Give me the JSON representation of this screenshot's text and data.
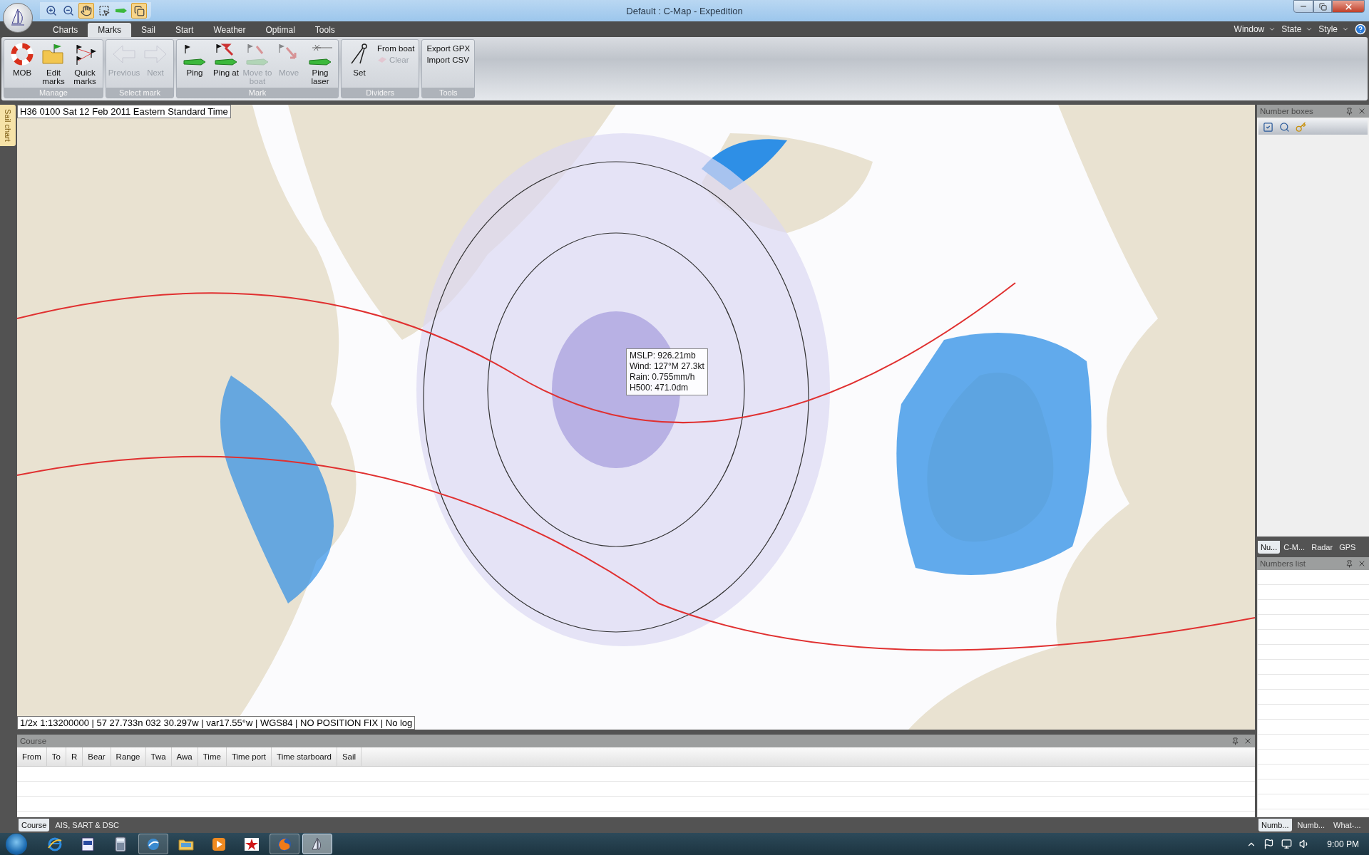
{
  "window": {
    "title": "Default : C-Map - Expedition"
  },
  "ribbon_tabs": [
    {
      "label": "Charts",
      "selected": false
    },
    {
      "label": "Marks",
      "selected": true
    },
    {
      "label": "Sail",
      "selected": false
    },
    {
      "label": "Start",
      "selected": false
    },
    {
      "label": "Weather",
      "selected": false
    },
    {
      "label": "Optimal",
      "selected": false
    },
    {
      "label": "Tools",
      "selected": false
    }
  ],
  "menu_right": [
    "Window",
    "State",
    "Style"
  ],
  "ribbon_groups": [
    {
      "title": "Manage",
      "buttons": [
        {
          "label": "MOB",
          "kind": "large",
          "disabled": false
        },
        {
          "label": "Edit marks",
          "kind": "large",
          "disabled": false
        },
        {
          "label": "Quick marks",
          "kind": "large",
          "disabled": false
        }
      ]
    },
    {
      "title": "Select mark",
      "buttons": [
        {
          "label": "Previous",
          "kind": "large",
          "disabled": true
        },
        {
          "label": "Next",
          "kind": "large",
          "disabled": true
        }
      ]
    },
    {
      "title": "Mark",
      "buttons": [
        {
          "label": "Ping",
          "kind": "large",
          "disabled": false
        },
        {
          "label": "Ping at",
          "kind": "large",
          "disabled": false
        },
        {
          "label": "Move to boat",
          "kind": "large",
          "disabled": true
        },
        {
          "label": "Move",
          "kind": "large",
          "disabled": true
        },
        {
          "label": "Ping laser",
          "kind": "large",
          "disabled": false
        }
      ]
    },
    {
      "title": "Dividers",
      "buttons": [
        {
          "label": "Set",
          "kind": "large",
          "disabled": false
        },
        {
          "label": "From boat",
          "kind": "small",
          "disabled": false
        },
        {
          "label": "Clear",
          "kind": "small",
          "disabled": true
        }
      ]
    },
    {
      "title": "Tools",
      "buttons": [
        {
          "label": "Export GPX",
          "kind": "small",
          "disabled": false
        },
        {
          "label": "Import CSV",
          "kind": "small",
          "disabled": false
        }
      ]
    }
  ],
  "side_tab": "Sail chart",
  "map": {
    "kind": "picture",
    "time_label": "H36 0100 Sat 12 Feb 2011 Eastern Standard Time",
    "tooltip": [
      "MSLP: 926.21mb",
      "Wind: 127°M 27.3kt",
      "Rain: 0.755mm/h",
      "H500: 471.0dm"
    ],
    "status_line": "1/2x 1:13200000 | 57 27.733n 032 30.297w | var17.55°w | WGS84 | NO POSITION FIX | No log"
  },
  "course_panel": {
    "title": "Course",
    "columns": [
      "From",
      "To",
      "R",
      "Bear",
      "Range",
      "Twa",
      "Awa",
      "Time",
      "Time port",
      "Time starboard",
      "Sail"
    ]
  },
  "bottom_tabs": [
    {
      "label": "Course",
      "selected": true
    },
    {
      "label": "AIS, SART & DSC",
      "selected": false
    }
  ],
  "number_boxes_panel": {
    "title": "Number boxes"
  },
  "right_tabs": [
    {
      "label": "Nu...",
      "selected": true
    },
    {
      "label": "C-M...",
      "selected": false
    },
    {
      "label": "Radar",
      "selected": false
    },
    {
      "label": "GPS",
      "selected": false
    }
  ],
  "numbers_list_panel": {
    "title": "Numbers list"
  },
  "right_bottom_tabs": [
    {
      "label": "Numb...",
      "selected": true
    },
    {
      "label": "Numb...",
      "selected": false
    },
    {
      "label": "What-...",
      "selected": false
    }
  ],
  "taskbar": {
    "items": [
      {
        "running": false,
        "selected": false
      },
      {
        "running": false,
        "selected": false
      },
      {
        "running": false,
        "selected": false
      },
      {
        "running": true,
        "selected": false
      },
      {
        "running": false,
        "selected": false
      },
      {
        "running": false,
        "selected": false
      },
      {
        "running": false,
        "selected": false
      },
      {
        "running": true,
        "selected": false
      },
      {
        "running": true,
        "selected": true
      }
    ],
    "clock": "9:00 PM"
  }
}
